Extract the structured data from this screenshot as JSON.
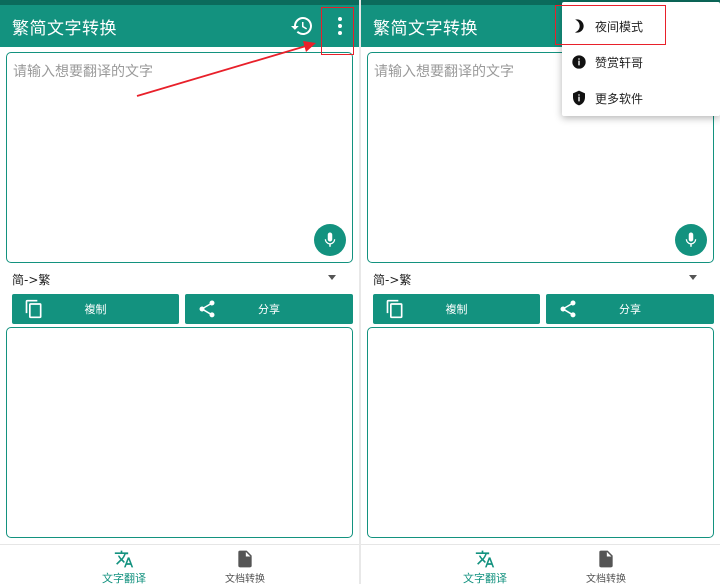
{
  "app": {
    "title": "繁简文字转换",
    "input_placeholder": "请输入想要翻译的文字",
    "direction_label": "简->繁",
    "copy_label": "複制",
    "share_label": "分享"
  },
  "bottom_nav": [
    {
      "label": "文字翻译",
      "icon": "translate-icon",
      "active": true
    },
    {
      "label": "文档转换",
      "icon": "document-icon",
      "active": false
    }
  ],
  "overflow_menu": [
    {
      "label": "夜间模式",
      "icon": "half-moon-icon"
    },
    {
      "label": "赞赏轩哥",
      "icon": "info-icon"
    },
    {
      "label": "更多软件",
      "icon": "shield-info-icon"
    }
  ],
  "colors": {
    "primary": "#13927f",
    "status_bar": "#0b6b5c",
    "annotation": "#e8202a",
    "placeholder": "#9a9a9a"
  }
}
